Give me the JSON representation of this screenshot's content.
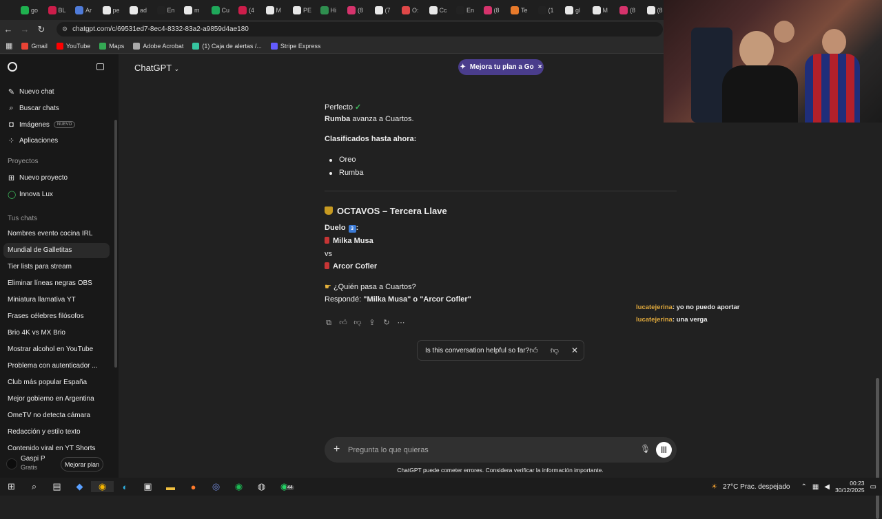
{
  "browser": {
    "tabs": [
      {
        "label": "go",
        "color": "#1fb14f"
      },
      {
        "label": "BL",
        "color": "#cc1d4a"
      },
      {
        "label": "Ar",
        "color": "#4f7bd9"
      },
      {
        "label": "pe",
        "color": "#e8e8e8"
      },
      {
        "label": "ad",
        "color": "#e8e8e8"
      },
      {
        "label": "En",
        "color": "#222222"
      },
      {
        "label": "m",
        "color": "#e8e8e8"
      },
      {
        "label": "Cu",
        "color": "#1fa85a"
      },
      {
        "label": "(4",
        "color": "#cc1d4a"
      },
      {
        "label": "M",
        "color": "#e8e8e8"
      },
      {
        "label": "PE",
        "color": "#e8e8e8"
      },
      {
        "label": "Hi",
        "color": "#2f8f4f"
      },
      {
        "label": "(8",
        "color": "#d6336c"
      },
      {
        "label": "(7",
        "color": "#e8e8e8"
      },
      {
        "label": "O:",
        "color": "#e04848"
      },
      {
        "label": "Cc",
        "color": "#e8e8e8"
      },
      {
        "label": "En",
        "color": "#222222"
      },
      {
        "label": "(8",
        "color": "#d6336c"
      },
      {
        "label": "Te",
        "color": "#e87a2b"
      },
      {
        "label": "(1",
        "color": "#222222"
      },
      {
        "label": "gl",
        "color": "#e8e8e8"
      },
      {
        "label": "M",
        "color": "#e8e8e8"
      },
      {
        "label": "(8",
        "color": "#d6336c"
      },
      {
        "label": "(8",
        "color": "#e8e8e8"
      }
    ],
    "url": "chatgpt.com/c/69531ed7-8ec4-8332-83a2-a9859d4ae180",
    "bookmarks": [
      {
        "label": "Gmail",
        "color": "#ea4335"
      },
      {
        "label": "YouTube",
        "color": "#ff0000"
      },
      {
        "label": "Maps",
        "color": "#34a853"
      },
      {
        "label": "Adobe Acrobat",
        "color": "#aaaaaa"
      },
      {
        "label": "(1) Caja de alertas /...",
        "color": "#36c5a0"
      },
      {
        "label": "Stripe Express",
        "color": "#635bff"
      }
    ]
  },
  "sidebar": {
    "nav": [
      {
        "label": "Nuevo chat",
        "icon": "edit-icon"
      },
      {
        "label": "Buscar chats",
        "icon": "search-icon"
      },
      {
        "label": "Imágenes",
        "icon": "image-icon",
        "badge": "NUEVO"
      },
      {
        "label": "Aplicaciones",
        "icon": "apps-icon"
      }
    ],
    "projects_title": "Proyectos",
    "projects": [
      {
        "label": "Nuevo proyecto",
        "icon": "folder-plus-icon"
      },
      {
        "label": "Innova Lux",
        "icon": "circle-icon"
      }
    ],
    "chats_title": "Tus chats",
    "chats": [
      "Nombres evento cocina IRL",
      "Mundial de Galletitas",
      "Tier lists para stream",
      "Eliminar líneas negras OBS",
      "Miniatura llamativa YT",
      "Frases célebres filósofos",
      "Brio 4K vs MX Brio",
      "Mostrar alcohol en YouTube",
      "Problema con autenticador ...",
      "Club más popular España",
      "Mejor gobierno en Argentina",
      "OmeTV no detecta cámara",
      "Redacción y estilo texto",
      "Contenido viral en YT Shorts"
    ],
    "user": {
      "name": "Gaspi P",
      "plan": "Gratis",
      "upgrade": "Mejorar plan"
    }
  },
  "header": {
    "model": "ChatGPT",
    "promo": "Mejora tu plan a Go"
  },
  "conversation": {
    "line1": "Perfecto",
    "line2_bold": "Rumba",
    "line2_rest": " avanza a Cuartos.",
    "classified_title": "Clasificados hasta ahora:",
    "classified": [
      "Oreo",
      "Rumba"
    ],
    "heading": "OCTAVOS – Tercera Llave",
    "duel_label": "Duelo",
    "duel_number": "3",
    "duel_colon": ":",
    "contender_a": "Milka Musa",
    "vs": "vs",
    "contender_b": "Arcor Cofler",
    "question": "¿Quién pasa a Cuartos?",
    "answer_prefix": "Respondé: ",
    "answer_options": "\"Milka Musa\" o \"Arcor Cofler\""
  },
  "feedback": {
    "question": "Is this conversation helpful so far?"
  },
  "composer": {
    "placeholder": "Pregunta lo que quieras"
  },
  "disclaimer": "ChatGPT puede cometer errores. Considera verificar la información importante.",
  "stream_chat": [
    {
      "user": "lucatejerina",
      "message": ": yo no puedo aportar"
    },
    {
      "user": "lucatejerina",
      "message": ": una verga"
    }
  ],
  "taskbar": {
    "weather": "27°C  Prac. despejado",
    "time": "00:23",
    "date": "30/12/2025",
    "badge": "44"
  }
}
